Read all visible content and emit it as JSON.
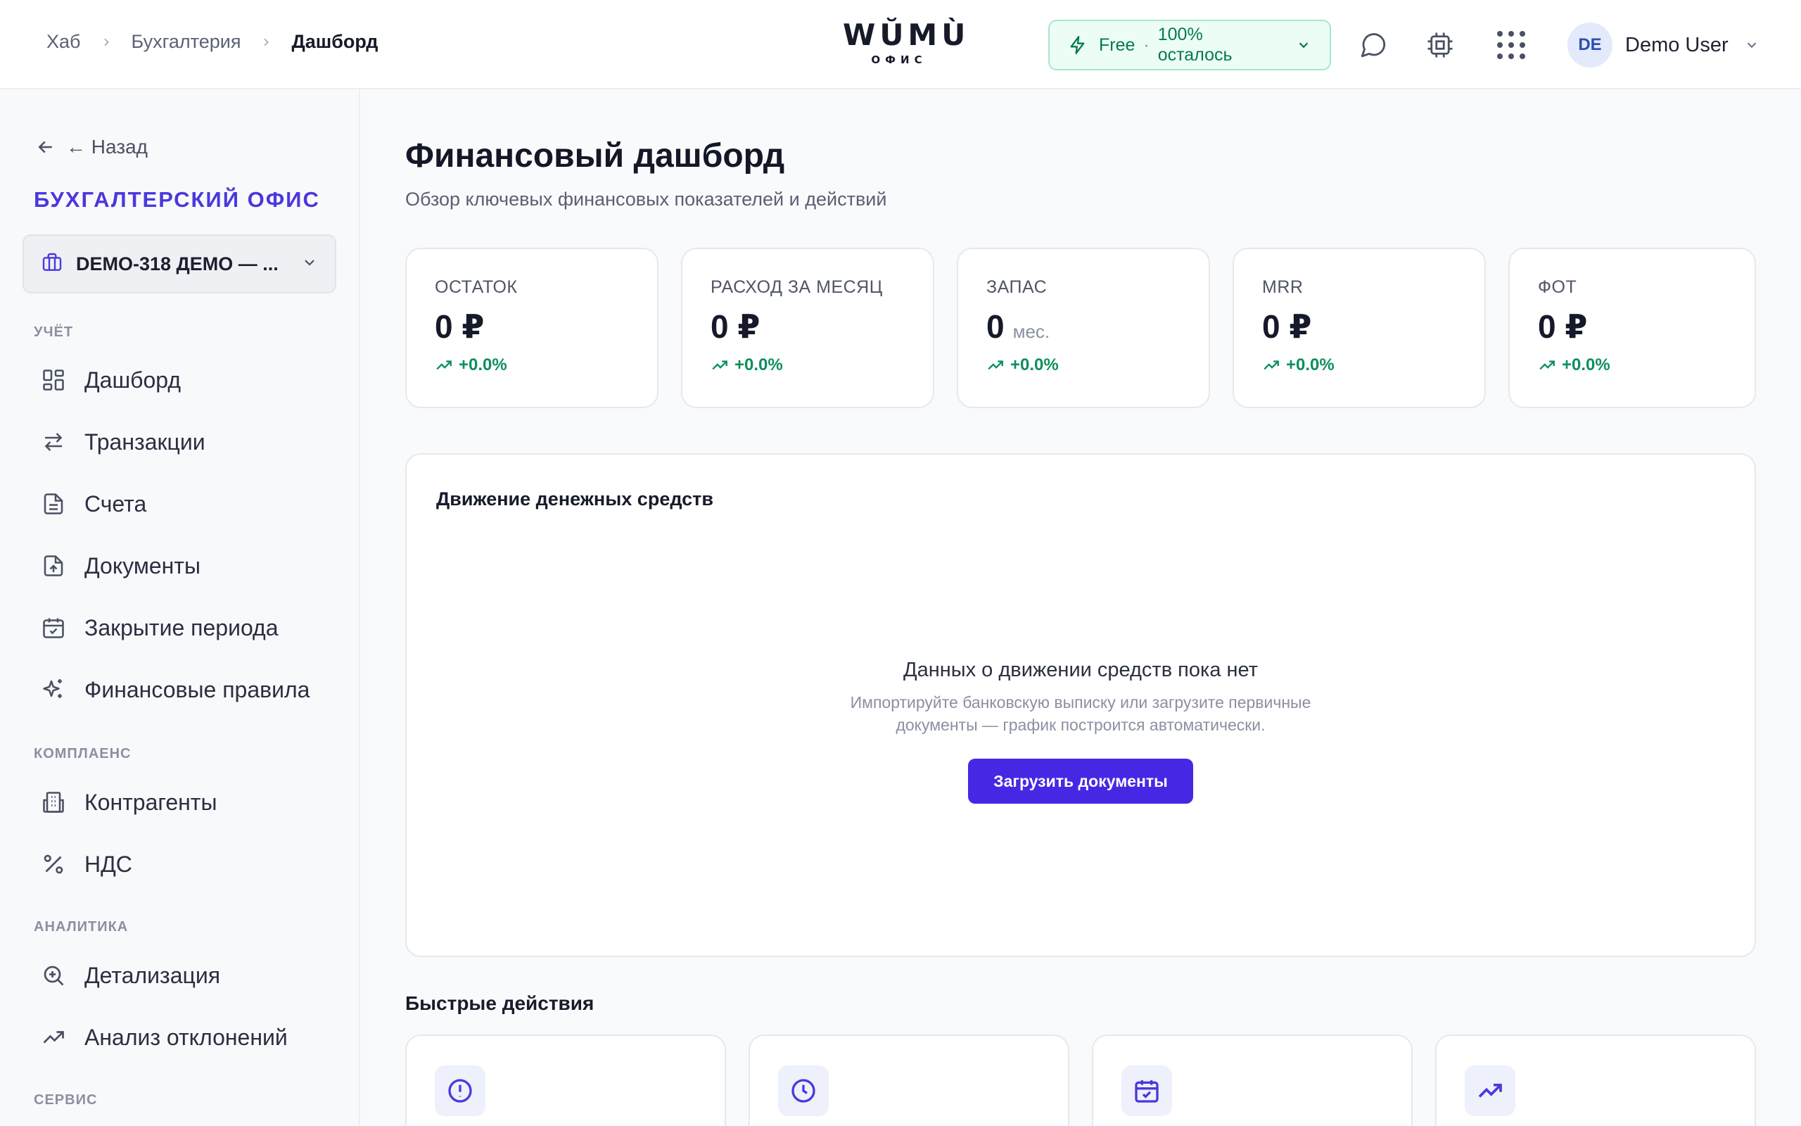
{
  "breadcrumb": {
    "items": [
      "Хаб",
      "Бухгалтерия"
    ],
    "current": "Дашборд"
  },
  "logo": {
    "mark": "WŬMÙ",
    "sub": "ОФИС"
  },
  "plan": {
    "name": "Free",
    "separator": "·",
    "remaining": "100% осталось"
  },
  "user": {
    "initials": "DE",
    "name": "Demo User"
  },
  "sidebar": {
    "back_label": "← Назад",
    "brand": "БУХГАЛТЕРСКИЙ ОФИС",
    "org_name": "DEMO-318 ДЕМО — ...",
    "sections": {
      "uchet": "УЧЁТ",
      "compliance": "КОМПЛАЕНС",
      "analytics": "АНАЛИТИКА",
      "service": "СЕРВИС"
    },
    "items": {
      "dashboard": "Дашборд",
      "transactions": "Транзакции",
      "invoices": "Счета",
      "documents": "Документы",
      "period_close": "Закрытие периода",
      "fin_rules": "Финансовые правила",
      "counterparties": "Контрагенты",
      "vat": "НДС",
      "drilldown": "Детализация",
      "variance": "Анализ отклонений"
    }
  },
  "main": {
    "title": "Финансовый дашборд",
    "subtitle": "Обзор ключевых финансовых показателей и действий",
    "kpis": [
      {
        "label": "ОСТАТОК",
        "value": "0 ₽",
        "unit": "",
        "delta": "+0.0%"
      },
      {
        "label": "РАСХОД ЗА МЕСЯЦ",
        "value": "0 ₽",
        "unit": "",
        "delta": "+0.0%"
      },
      {
        "label": "ЗАПАС",
        "value": "0",
        "unit": "мес.",
        "delta": "+0.0%"
      },
      {
        "label": "MRR",
        "value": "0 ₽",
        "unit": "",
        "delta": "+0.0%"
      },
      {
        "label": "ФОТ",
        "value": "0 ₽",
        "unit": "",
        "delta": "+0.0%"
      }
    ],
    "cashflow": {
      "title": "Движение денежных средств",
      "empty_title": "Данных о движении средств пока нет",
      "empty_desc": "Импортируйте банковскую выписку или загрузите первичные документы — график построится автоматически.",
      "upload_label": "Загрузить документы"
    },
    "quick_actions": {
      "title": "Быстрые действия"
    }
  },
  "colors": {
    "accent": "#4628e4",
    "brand": "#4b38dd",
    "positive": "#0c8f5c",
    "plan_bg": "#ecfdf5"
  }
}
